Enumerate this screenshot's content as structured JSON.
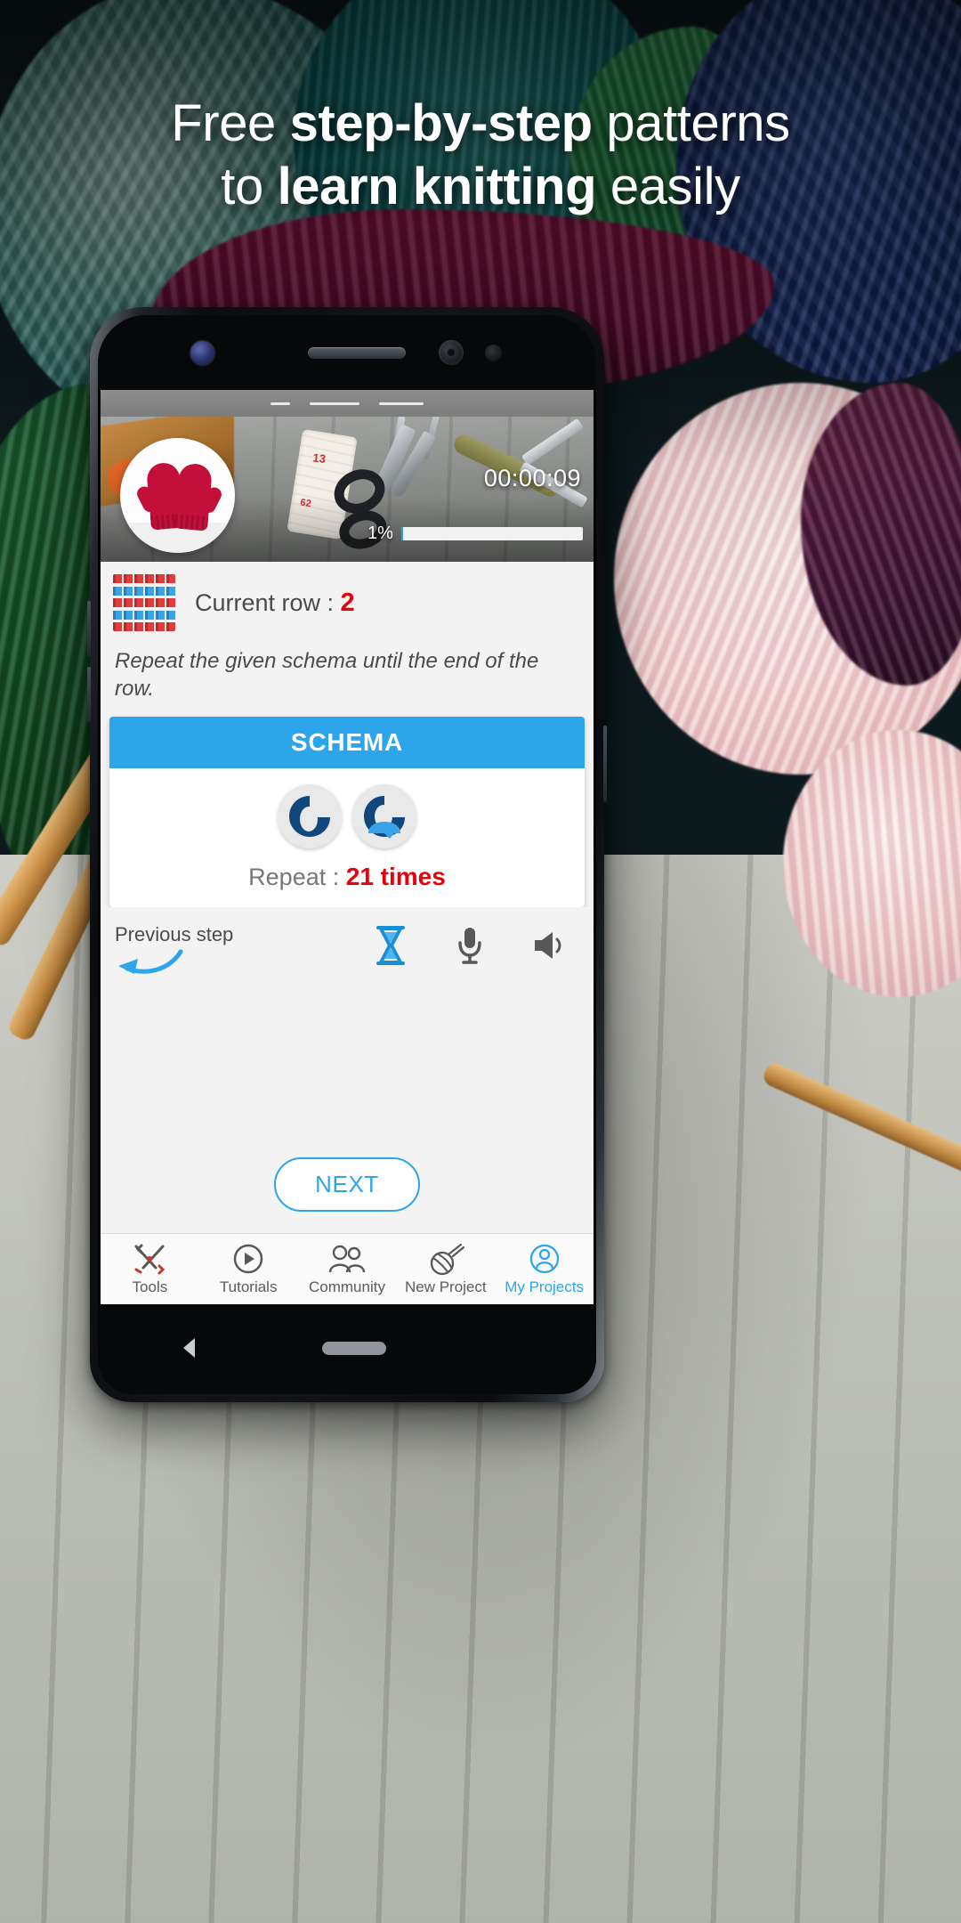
{
  "headline": {
    "line1_pre": "Free ",
    "line1_bold": "step-by-step",
    "line1_post": " patterns",
    "line2_pre": "to ",
    "line2_bold": "learn knitting",
    "line2_post": " easily"
  },
  "colors": {
    "accent": "#2ca5ea",
    "alert": "#e8000b",
    "text": "#4a4a4a",
    "schema_header_bg": "#2ca5ea"
  },
  "video": {
    "timer": "00:00:09",
    "percent_label": "1%",
    "progress_percent": 1,
    "thumbnail_alt": "red-mittens"
  },
  "row_section": {
    "label": "Current row : ",
    "value": "2",
    "pattern_rows": [
      "red",
      "blue",
      "red",
      "blue",
      "red"
    ]
  },
  "instruction": "Repeat the given schema until the end of the row.",
  "schema": {
    "title": "SCHEMA",
    "stitches": [
      "knit-stitch-icon",
      "purl-stitch-icon"
    ],
    "repeat_label": "Repeat : ",
    "repeat_value": "21 times"
  },
  "controls": {
    "previous_step": "Previous step",
    "icons": [
      "hourglass-icon",
      "microphone-icon",
      "speaker-icon"
    ]
  },
  "next_button": "NEXT",
  "tabbar": {
    "items": [
      {
        "label": "Tools",
        "icon": "tools-icon",
        "active": false
      },
      {
        "label": "Tutorials",
        "icon": "play-circle-icon",
        "active": false
      },
      {
        "label": "Community",
        "icon": "people-icon",
        "active": false
      },
      {
        "label": "New Project",
        "icon": "yarn-ball-icon",
        "active": false
      },
      {
        "label": "My Projects",
        "icon": "person-circle-icon",
        "active": true
      }
    ]
  }
}
